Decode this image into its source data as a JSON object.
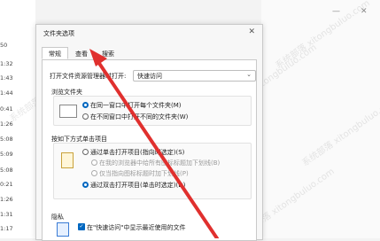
{
  "background": {
    "times": [
      "50",
      "1:32",
      "1:43",
      "1:44",
      "0:41",
      "1:26",
      "5:08",
      "5:09",
      "5:08",
      "0:21",
      "1:26",
      "1:31",
      "1:17",
      "1:45"
    ],
    "watermark": "系统部落 xitongbuluo.com",
    "window_controls": [
      "—",
      "✕"
    ]
  },
  "dialog": {
    "title": "文件夹选项",
    "close": "✕",
    "tabs": [
      "常规",
      "查看",
      "搜索"
    ],
    "open_label": "打开文件资源管理器时打开:",
    "open_value": "快速访问",
    "browse_group": {
      "title": "浏览文件夹",
      "options": [
        {
          "label": "在同一窗口中打开每个文件夹(M)",
          "checked": true
        },
        {
          "label": "在不同窗口中打开不同的文件夹(W)",
          "checked": false
        }
      ]
    },
    "click_group": {
      "title": "按如下方式单击项目",
      "options": [
        {
          "label": "通过单击打开项目(指向时选定)(S)",
          "checked": false,
          "disabled": false
        },
        {
          "label": "在我的浏览器中给所有图标标题加下划线(B)",
          "checked": false,
          "disabled": true
        },
        {
          "label": "仅当指向图标标题时加下划线(P)",
          "checked": false,
          "disabled": true
        },
        {
          "label": "通过双击打开项目(单击时选定)(D)",
          "checked": true,
          "disabled": false
        }
      ]
    },
    "privacy": {
      "title": "隐私",
      "item": "在\"快速访问\"中显示最近使用的文件"
    }
  },
  "annotation": {
    "color": "#e0302e"
  }
}
